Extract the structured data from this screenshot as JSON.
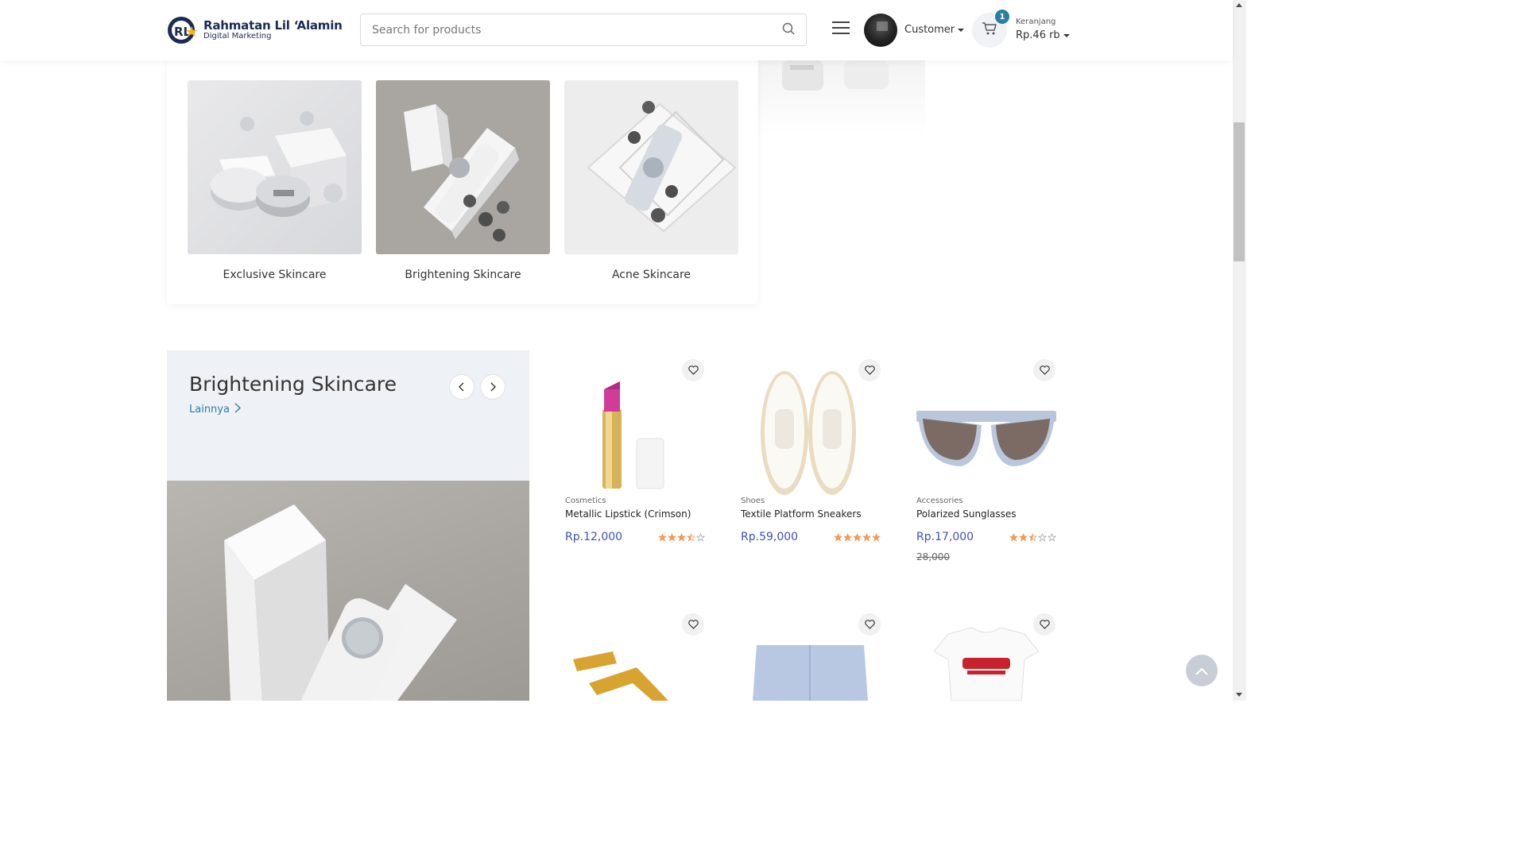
{
  "header": {
    "brand_title": "Rahmatan Lil ‘Alamin",
    "brand_subtitle": "Digital Marketing",
    "search_placeholder": "Search for products",
    "user_label": "Customer",
    "cart_count": "1",
    "cart_label": "Keranjang",
    "cart_total": "Rp.46 rb"
  },
  "categories": [
    {
      "name": "Exclusive Skincare"
    },
    {
      "name": "Brightening Skincare"
    },
    {
      "name": "Acne Skincare"
    }
  ],
  "section": {
    "title": "Brightening Skincare",
    "more_label": "Lainnya"
  },
  "products": [
    {
      "category": "Cosmetics",
      "name": "Metallic Lipstick (Crimson)",
      "price": "Rp.12,000",
      "old_price": "",
      "rating": 3.5
    },
    {
      "category": "Shoes",
      "name": "Textile Platform Sneakers",
      "price": "Rp.59,000",
      "old_price": "",
      "rating": 5
    },
    {
      "category": "Accessories",
      "name": "Polarized Sunglasses",
      "price": "Rp.17,000",
      "old_price": "28,000",
      "rating": 2.5
    }
  ],
  "colors": {
    "accent": "#2a7fa0",
    "price": "#3f51b5",
    "star": "#f39a5a"
  }
}
